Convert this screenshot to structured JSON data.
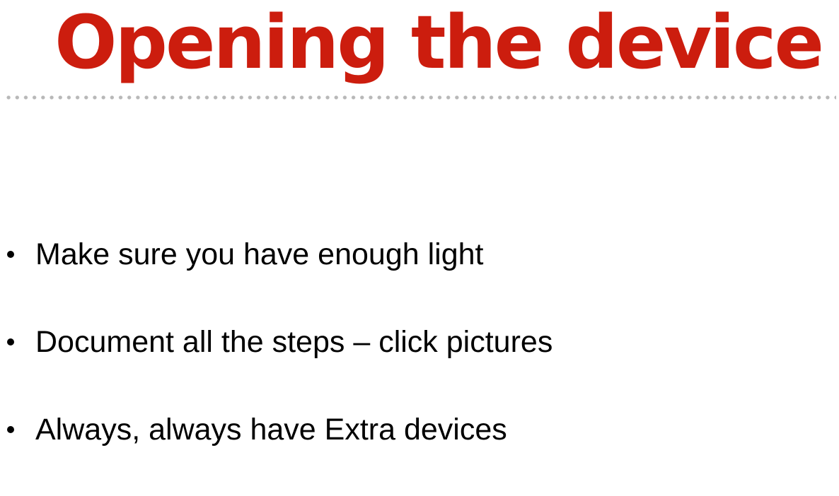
{
  "slide": {
    "title": "Opening the device",
    "bullets": [
      "Make sure you have enough light",
      "Document all the steps – click pictures",
      "Always, always have Extra devices"
    ]
  },
  "colors": {
    "title": "#cc1d0e",
    "divider_dots": "#b8b8b8",
    "body_text": "#000000",
    "background": "#ffffff"
  }
}
